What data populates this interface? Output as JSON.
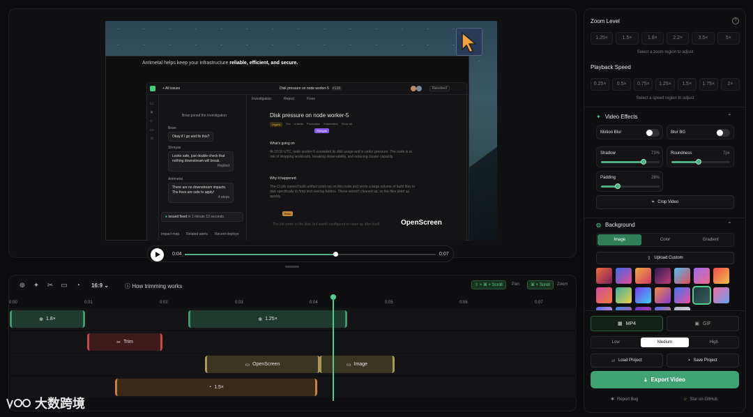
{
  "preview": {
    "inner_text_prefix": "Antimetal helps keep your infrastructure",
    "inner_text_bold": "reliable, efficient, and secure.",
    "app": {
      "back": "All issues",
      "issue_title": "Disk pressure on node worker-5",
      "issue_id": "#138",
      "status": "Resolved",
      "tabs": [
        "Investigation",
        "Report",
        "Fixes"
      ],
      "joined": "Brian joined the investigation",
      "chat": [
        {
          "name": "Brian",
          "text": "Okay if I go and fix this?"
        },
        {
          "name": "Shreyas",
          "text": "Looks safe, just double check that nothing downstream will break.",
          "meta": "Replied"
        },
        {
          "name": "Antimetal",
          "text": "There are no downstream impacts. The fixes are safe to apply!",
          "meta": "4 steps"
        }
      ],
      "issue_fixed": "Issued fixed",
      "issue_fixed_time": "in 1 minute 13 seconds",
      "bottom_tabs": [
        "Impact map",
        "Related alerts",
        "Recent deploys"
      ],
      "heading": "Disk pressure on node worker-5",
      "tags": [
        "Urgent",
        "Sev",
        "4 alerts",
        "Production",
        "Kubernetes",
        "Show all"
      ],
      "tooltip": "Shreyas",
      "whats_going_on": "What's going on",
      "body1": "At 10:30 UTC, node worker-5 exceeded its disk usage and is under pressure. The node is at risk of dropping workloads, breaking observability, and reducing cluster capacity.",
      "why": "Why it happened",
      "body2": "The CI job named build-artifact-prod ran on this node and wrote a large volume of build files to disk specifically to /tmp and overlay folders. These weren't cleaned up, so the files piled up quickly.",
      "cursor_tag": "Brian",
      "footer_line": "The job wrote to the disk, but wasn't configured to clean up after itself."
    },
    "brand": "OpenScreen",
    "current_time": "0:04",
    "total_time": "0:07",
    "progress": 0.6
  },
  "timeline": {
    "aspect": "16:9",
    "help": "How trimming works",
    "pan_keys": "⇧ + ⌘ + Scroll",
    "pan_label": "Pan",
    "zoom_keys": "⌘ + Scroll",
    "zoom_label": "Zoom",
    "ticks": [
      "0:00",
      "0:01",
      "0:02",
      "0:03",
      "0:04",
      "0:05",
      "0:06",
      "0:07"
    ],
    "zoom_segments": [
      {
        "label": "1.8×"
      },
      {
        "label": "1.25×"
      }
    ],
    "trim_segments": [
      {
        "label": "Trim"
      }
    ],
    "annotation_segments": [
      {
        "label": "OpenScreen"
      },
      {
        "label": "Image"
      }
    ],
    "speed_segments": [
      {
        "label": "1.5×"
      }
    ]
  },
  "watermark": "大数跨境",
  "panel": {
    "zoom_title": "Zoom Level",
    "zoom_options": [
      "1.25×",
      "1.5×",
      "1.8×",
      "2.2×",
      "3.5×",
      "5×"
    ],
    "zoom_hint": "Select a zoom region to adjust",
    "speed_title": "Playback Speed",
    "speed_options": [
      "0.25×",
      "0.5×",
      "0.75×",
      "1.25×",
      "1.5×",
      "1.75×",
      "2×"
    ],
    "speed_hint": "Select a speed region to adjust",
    "effects_title": "Video Effects",
    "motion_blur": "Motion Blur",
    "blur_bg": "Blur BG",
    "shadow": {
      "label": "Shadow",
      "value": "73%",
      "level": 0.73
    },
    "roundness": {
      "label": "Roundness",
      "value": "7px",
      "level": 0.47
    },
    "padding": {
      "label": "Padding",
      "value": "28%",
      "level": 0.28
    },
    "crop": "Crop Video",
    "background_title": "Background",
    "bg_tabs": [
      "Image",
      "Color",
      "Gradient"
    ],
    "upload": "Upload Custom",
    "formats": [
      "MP4",
      "GIF"
    ],
    "quality": [
      "Low",
      "Medium",
      "High"
    ],
    "load": "Load Project",
    "save": "Save Project",
    "export": "Export Video",
    "report": "Report Bug",
    "star": "Star on GitHub",
    "colors": {
      "accent": "#3fa376",
      "playhead": "#4fcf8f"
    }
  }
}
